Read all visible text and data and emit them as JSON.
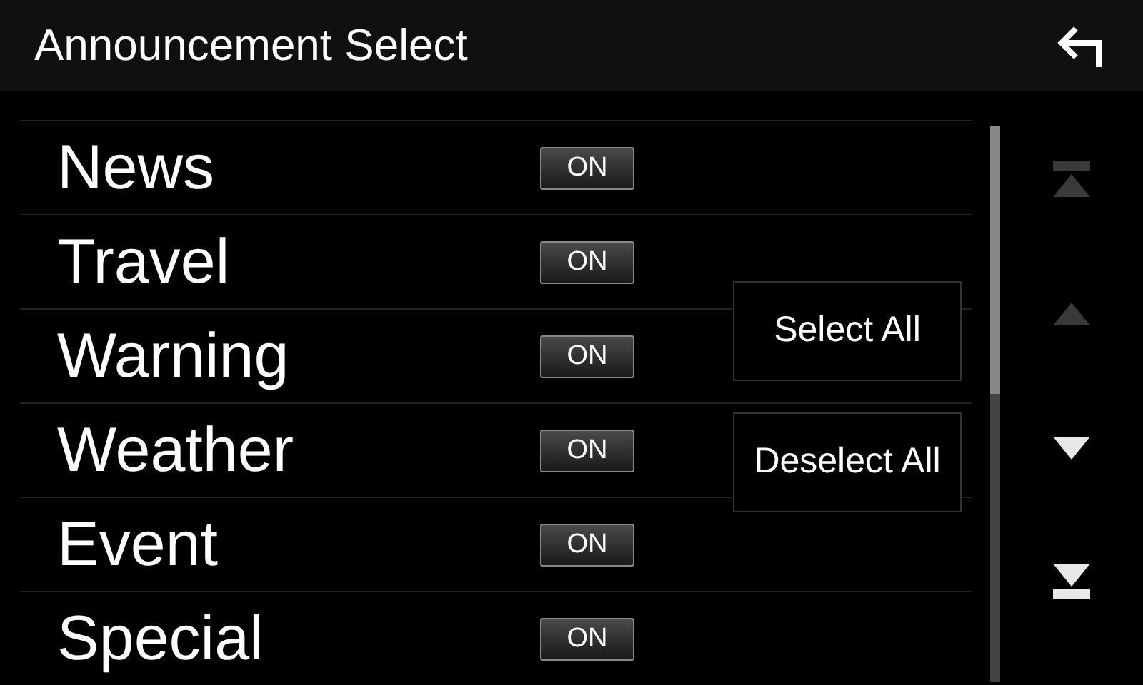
{
  "window": {
    "title": "Announcement Select"
  },
  "items": [
    {
      "label": "News",
      "toggle": "ON",
      "on": true
    },
    {
      "label": "Travel",
      "toggle": "ON",
      "on": true
    },
    {
      "label": "Warning",
      "toggle": "ON",
      "on": true
    },
    {
      "label": "Weather",
      "toggle": "ON",
      "on": true
    },
    {
      "label": "Event",
      "toggle": "ON",
      "on": true
    },
    {
      "label": "Special",
      "toggle": "ON",
      "on": true
    }
  ],
  "buttons": [
    "Select All",
    "Deselect All"
  ],
  "scroll_nav": [
    {
      "kind": "top",
      "disabled": true
    },
    {
      "kind": "up",
      "disabled": true
    },
    {
      "kind": "down",
      "disabled": false
    },
    {
      "kind": "bottom",
      "disabled": false
    }
  ]
}
